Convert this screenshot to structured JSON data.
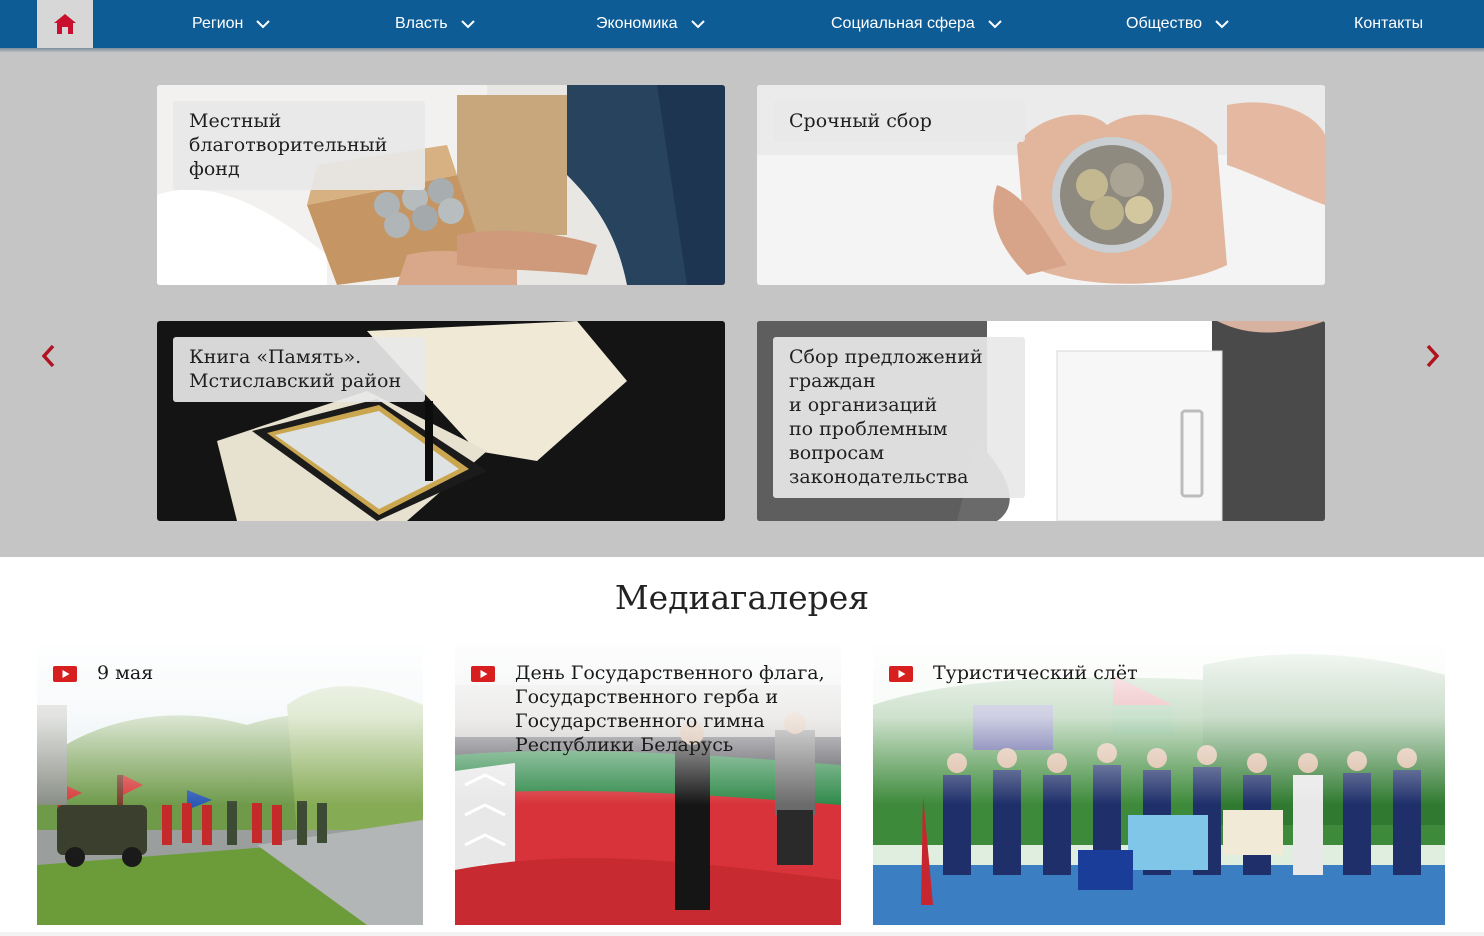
{
  "nav": {
    "home_icon": "home-icon",
    "items": [
      {
        "label": "Регион",
        "has_dropdown": true
      },
      {
        "label": "Власть",
        "has_dropdown": true
      },
      {
        "label": "Экономика",
        "has_dropdown": true
      },
      {
        "label": "Социальная сфера",
        "has_dropdown": true
      },
      {
        "label": "Общество",
        "has_dropdown": true
      },
      {
        "label": "Контакты",
        "has_dropdown": false
      }
    ],
    "colors": {
      "bar": "#0e5c96",
      "home_bg": "#d7d7d7",
      "home_icon": "#c8102e"
    }
  },
  "banners": [
    {
      "label": "Местный\nблаготворительный\nфонд"
    },
    {
      "label": "Срочный сбор"
    },
    {
      "label": "Книга «Память».\nМстиславский район"
    },
    {
      "label": "Сбор предложений\nграждан\nи организаций\nпо проблемным\nвопросам\nзаконодательства"
    }
  ],
  "carousel": {
    "prev_icon": "chevron-left-icon",
    "next_icon": "chevron-right-icon",
    "arrow_color": "#b0121f"
  },
  "media": {
    "title": "Медиагалерея",
    "items": [
      {
        "title": "9 мая",
        "icon": "youtube-icon"
      },
      {
        "title": "День Государственного флага, Государственного герба и Государственного гимна Республики Беларусь",
        "icon": "youtube-icon"
      },
      {
        "title": "Туристический слёт",
        "icon": "youtube-icon"
      }
    ]
  }
}
